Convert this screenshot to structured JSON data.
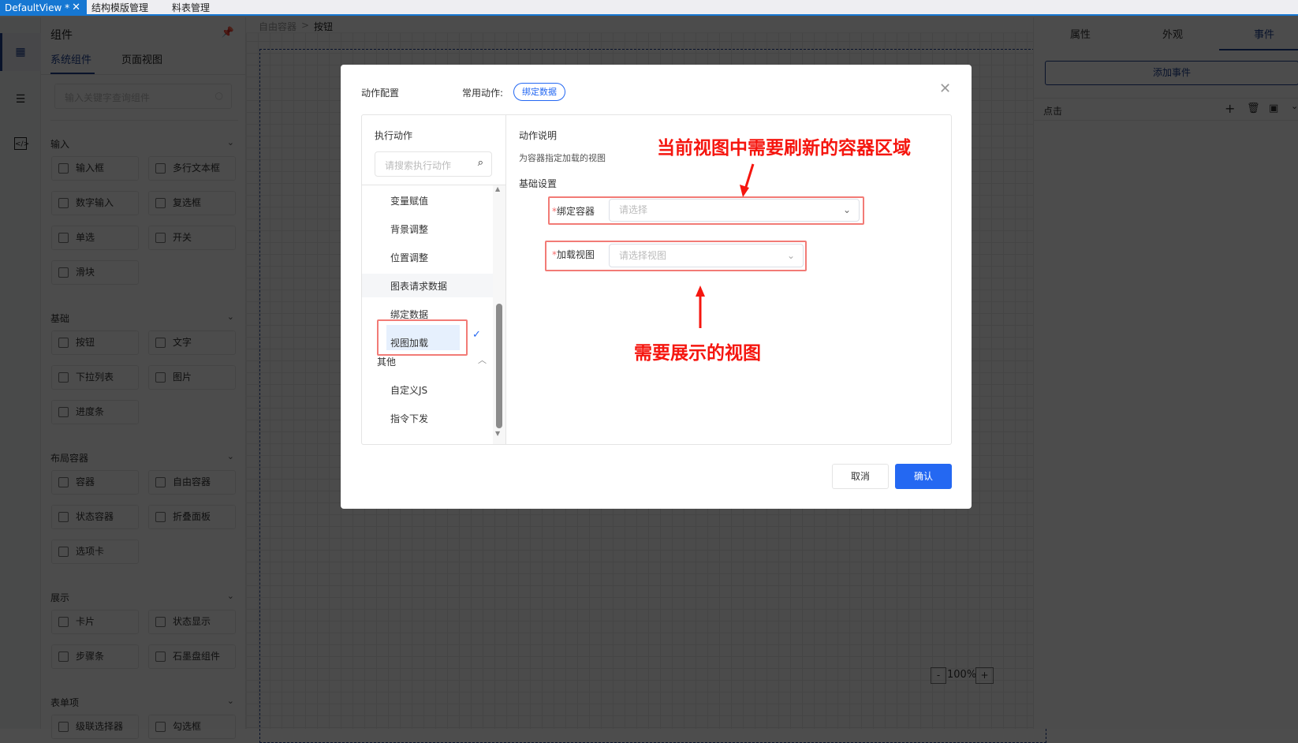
{
  "tabs": [
    {
      "label": "DefaultView *"
    },
    {
      "label": "结构模版管理"
    },
    {
      "label": "料表管理"
    }
  ],
  "breadcrumb": {
    "parent": "自由容器",
    "sep": ">",
    "current": "按钮"
  },
  "left_panel": {
    "title": "组件",
    "tabs": [
      "系统组件",
      "页面视图"
    ],
    "search_placeholder": "输入关键字查询组件",
    "sections": [
      {
        "title": "输入",
        "items": [
          "输入框",
          "多行文本框",
          "数字输入",
          "复选框",
          "单选",
          "开关",
          "滑块"
        ]
      },
      {
        "title": "基础",
        "items": [
          "按钮",
          "文字",
          "下拉列表",
          "图片",
          "进度条"
        ]
      },
      {
        "title": "布局容器",
        "items": [
          "容器",
          "自由容器",
          "状态容器",
          "折叠面板",
          "选项卡"
        ]
      },
      {
        "title": "展示",
        "items": [
          "卡片",
          "状态显示",
          "步骤条",
          "石墨盘组件"
        ]
      },
      {
        "title": "表单项",
        "items": [
          "级联选择器",
          "勾选框"
        ]
      }
    ]
  },
  "right_panel": {
    "tabs": [
      "属性",
      "外观",
      "事件"
    ],
    "active_tab": "事件",
    "add_event": "添加事件",
    "event_name": "点击"
  },
  "zoom": {
    "minus": "-",
    "value": "100%",
    "plus": "+"
  },
  "dialog": {
    "title": "动作配置",
    "common_label": "常用动作:",
    "common_chip": "绑定数据",
    "left": {
      "title": "执行动作",
      "search_placeholder": "请搜索执行动作",
      "items": [
        "变量赋值",
        "背景调整",
        "位置调整",
        "图表请求数据",
        "绑定数据",
        "视图加载"
      ],
      "selected": "视图加载",
      "group": "其他",
      "group_items": [
        "自定义JS",
        "指令下发"
      ]
    },
    "right": {
      "desc_title": "动作说明",
      "desc": "为容器指定加载的视图",
      "settings_title": "基础设置",
      "field1_label": "绑定容器",
      "field1_placeholder": "请选择",
      "field2_label": "加载视图",
      "field2_placeholder": "请选择视图",
      "required_mark": "*"
    },
    "cancel": "取消",
    "confirm": "确认"
  },
  "annotations": {
    "top": "当前视图中需要刷新的容器区域",
    "bottom": "需要展示的视图"
  },
  "colors": {
    "primary": "#2468f2",
    "annotation": "#f5160f",
    "tab_blue": "#1677d2"
  }
}
